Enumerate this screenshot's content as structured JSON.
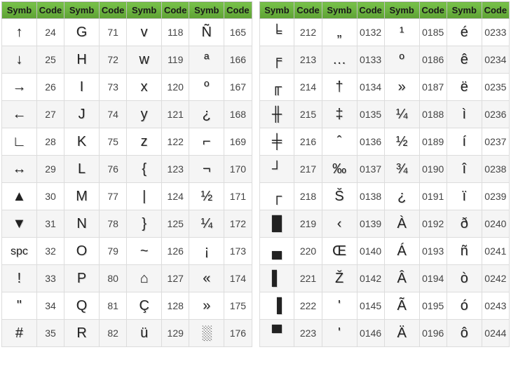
{
  "header": {
    "symb": "Symb",
    "code": "Code"
  },
  "left_block": {
    "columns": [
      [
        {
          "symb": "↑",
          "code": "24"
        },
        {
          "symb": "↓",
          "code": "25"
        },
        {
          "symb": "→",
          "code": "26"
        },
        {
          "symb": "←",
          "code": "27"
        },
        {
          "symb": "∟",
          "code": "28"
        },
        {
          "symb": "↔",
          "code": "29"
        },
        {
          "symb": "▲",
          "code": "30"
        },
        {
          "symb": "▼",
          "code": "31"
        },
        {
          "symb": "spc",
          "code": "32"
        },
        {
          "symb": "!",
          "code": "33"
        },
        {
          "symb": "\"",
          "code": "34"
        },
        {
          "symb": "#",
          "code": "35"
        }
      ],
      [
        {
          "symb": "G",
          "code": "71"
        },
        {
          "symb": "H",
          "code": "72"
        },
        {
          "symb": "I",
          "code": "73"
        },
        {
          "symb": "J",
          "code": "74"
        },
        {
          "symb": "K",
          "code": "75"
        },
        {
          "symb": "L",
          "code": "76"
        },
        {
          "symb": "M",
          "code": "77"
        },
        {
          "symb": "N",
          "code": "78"
        },
        {
          "symb": "O",
          "code": "79"
        },
        {
          "symb": "P",
          "code": "80"
        },
        {
          "symb": "Q",
          "code": "81"
        },
        {
          "symb": "R",
          "code": "82"
        }
      ],
      [
        {
          "symb": "v",
          "code": "118"
        },
        {
          "symb": "w",
          "code": "119"
        },
        {
          "symb": "x",
          "code": "120"
        },
        {
          "symb": "y",
          "code": "121"
        },
        {
          "symb": "z",
          "code": "122"
        },
        {
          "symb": "{",
          "code": "123"
        },
        {
          "symb": "|",
          "code": "124"
        },
        {
          "symb": "}",
          "code": "125"
        },
        {
          "symb": "~",
          "code": "126"
        },
        {
          "symb": "⌂",
          "code": "127"
        },
        {
          "symb": "Ç",
          "code": "128"
        },
        {
          "symb": "ü",
          "code": "129"
        }
      ],
      [
        {
          "symb": "Ñ",
          "code": "165"
        },
        {
          "symb": "ª",
          "code": "166"
        },
        {
          "symb": "º",
          "code": "167"
        },
        {
          "symb": "¿",
          "code": "168"
        },
        {
          "symb": "⌐",
          "code": "169"
        },
        {
          "symb": "¬",
          "code": "170"
        },
        {
          "symb": "½",
          "code": "171"
        },
        {
          "symb": "¼",
          "code": "172"
        },
        {
          "symb": "¡",
          "code": "173"
        },
        {
          "symb": "«",
          "code": "174"
        },
        {
          "symb": "»",
          "code": "175"
        },
        {
          "symb": "░",
          "code": "176"
        }
      ]
    ]
  },
  "right_block": {
    "columns": [
      [
        {
          "symb": "╘",
          "code": "212"
        },
        {
          "symb": "╒",
          "code": "213"
        },
        {
          "symb": "╓",
          "code": "214"
        },
        {
          "symb": "╫",
          "code": "215"
        },
        {
          "symb": "╪",
          "code": "216"
        },
        {
          "symb": "┘",
          "code": "217"
        },
        {
          "symb": "┌",
          "code": "218"
        },
        {
          "symb": "█",
          "code": "219"
        },
        {
          "symb": "▄",
          "code": "220"
        },
        {
          "symb": "▌",
          "code": "221"
        },
        {
          "symb": "▐",
          "code": "222"
        },
        {
          "symb": "▀",
          "code": "223"
        }
      ],
      [
        {
          "symb": "„",
          "code": "0132"
        },
        {
          "symb": "…",
          "code": "0133"
        },
        {
          "symb": "†",
          "code": "0134"
        },
        {
          "symb": "‡",
          "code": "0135"
        },
        {
          "symb": "ˆ",
          "code": "0136"
        },
        {
          "symb": "‰",
          "code": "0137"
        },
        {
          "symb": "Š",
          "code": "0138"
        },
        {
          "symb": "‹",
          "code": "0139"
        },
        {
          "symb": "Œ",
          "code": "0140"
        },
        {
          "symb": "Ž",
          "code": "0142"
        },
        {
          "symb": "'",
          "code": "0145"
        },
        {
          "symb": "'",
          "code": "0146"
        }
      ],
      [
        {
          "symb": "¹",
          "code": "0185"
        },
        {
          "symb": "º",
          "code": "0186"
        },
        {
          "symb": "»",
          "code": "0187"
        },
        {
          "symb": "¼",
          "code": "0188"
        },
        {
          "symb": "½",
          "code": "0189"
        },
        {
          "symb": "¾",
          "code": "0190"
        },
        {
          "symb": "¿",
          "code": "0191"
        },
        {
          "symb": "À",
          "code": "0192"
        },
        {
          "symb": "Á",
          "code": "0193"
        },
        {
          "symb": "Â",
          "code": "0194"
        },
        {
          "symb": "Ã",
          "code": "0195"
        },
        {
          "symb": "Ä",
          "code": "0196"
        }
      ],
      [
        {
          "symb": "é",
          "code": "0233"
        },
        {
          "symb": "ê",
          "code": "0234"
        },
        {
          "symb": "ë",
          "code": "0235"
        },
        {
          "symb": "ì",
          "code": "0236"
        },
        {
          "symb": "í",
          "code": "0237"
        },
        {
          "symb": "î",
          "code": "0238"
        },
        {
          "symb": "ï",
          "code": "0239"
        },
        {
          "symb": "ð",
          "code": "0240"
        },
        {
          "symb": "ñ",
          "code": "0241"
        },
        {
          "symb": "ò",
          "code": "0242"
        },
        {
          "symb": "ó",
          "code": "0243"
        },
        {
          "symb": "ô",
          "code": "0244"
        }
      ]
    ]
  }
}
